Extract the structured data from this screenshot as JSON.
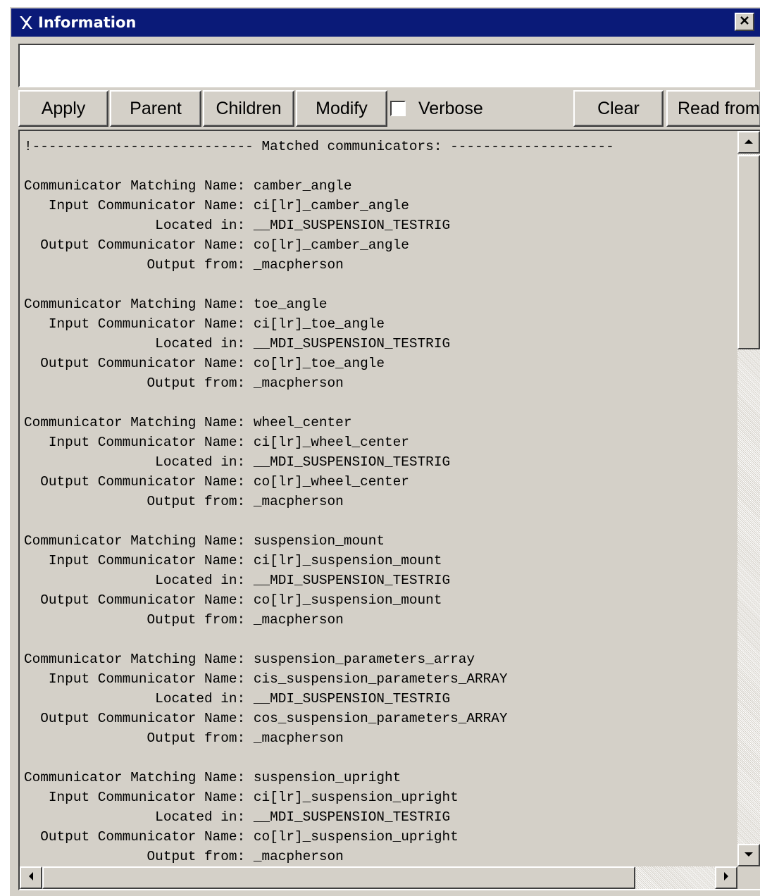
{
  "window": {
    "title": "Information",
    "close_glyph": "✕"
  },
  "command_input": {
    "value": ""
  },
  "toolbar": {
    "apply_label": "Apply",
    "parent_label": "Parent",
    "children_label": "Children",
    "modify_label": "Modify",
    "verbose_label": "Verbose",
    "verbose_checked": false,
    "clear_label": "Clear",
    "read_from_label": "Read from"
  },
  "info": {
    "lines": [
      "!--------------------------- Matched communicators: --------------------",
      "",
      "Communicator Matching Name: camber_angle",
      "   Input Communicator Name: ci[lr]_camber_angle",
      "                Located in: __MDI_SUSPENSION_TESTRIG",
      "  Output Communicator Name: co[lr]_camber_angle",
      "               Output from: _macpherson",
      "",
      "Communicator Matching Name: toe_angle",
      "   Input Communicator Name: ci[lr]_toe_angle",
      "                Located in: __MDI_SUSPENSION_TESTRIG",
      "  Output Communicator Name: co[lr]_toe_angle",
      "               Output from: _macpherson",
      "",
      "Communicator Matching Name: wheel_center",
      "   Input Communicator Name: ci[lr]_wheel_center",
      "                Located in: __MDI_SUSPENSION_TESTRIG",
      "  Output Communicator Name: co[lr]_wheel_center",
      "               Output from: _macpherson",
      "",
      "Communicator Matching Name: suspension_mount",
      "   Input Communicator Name: ci[lr]_suspension_mount",
      "                Located in: __MDI_SUSPENSION_TESTRIG",
      "  Output Communicator Name: co[lr]_suspension_mount",
      "               Output from: _macpherson",
      "",
      "Communicator Matching Name: suspension_parameters_array",
      "   Input Communicator Name: cis_suspension_parameters_ARRAY",
      "                Located in: __MDI_SUSPENSION_TESTRIG",
      "  Output Communicator Name: cos_suspension_parameters_ARRAY",
      "               Output from: _macpherson",
      "",
      "Communicator Matching Name: suspension_upright",
      "   Input Communicator Name: ci[lr]_suspension_upright",
      "                Located in: __MDI_SUSPENSION_TESTRIG",
      "  Output Communicator Name: co[lr]_suspension_upright",
      "               Output from: _macpherson"
    ]
  }
}
